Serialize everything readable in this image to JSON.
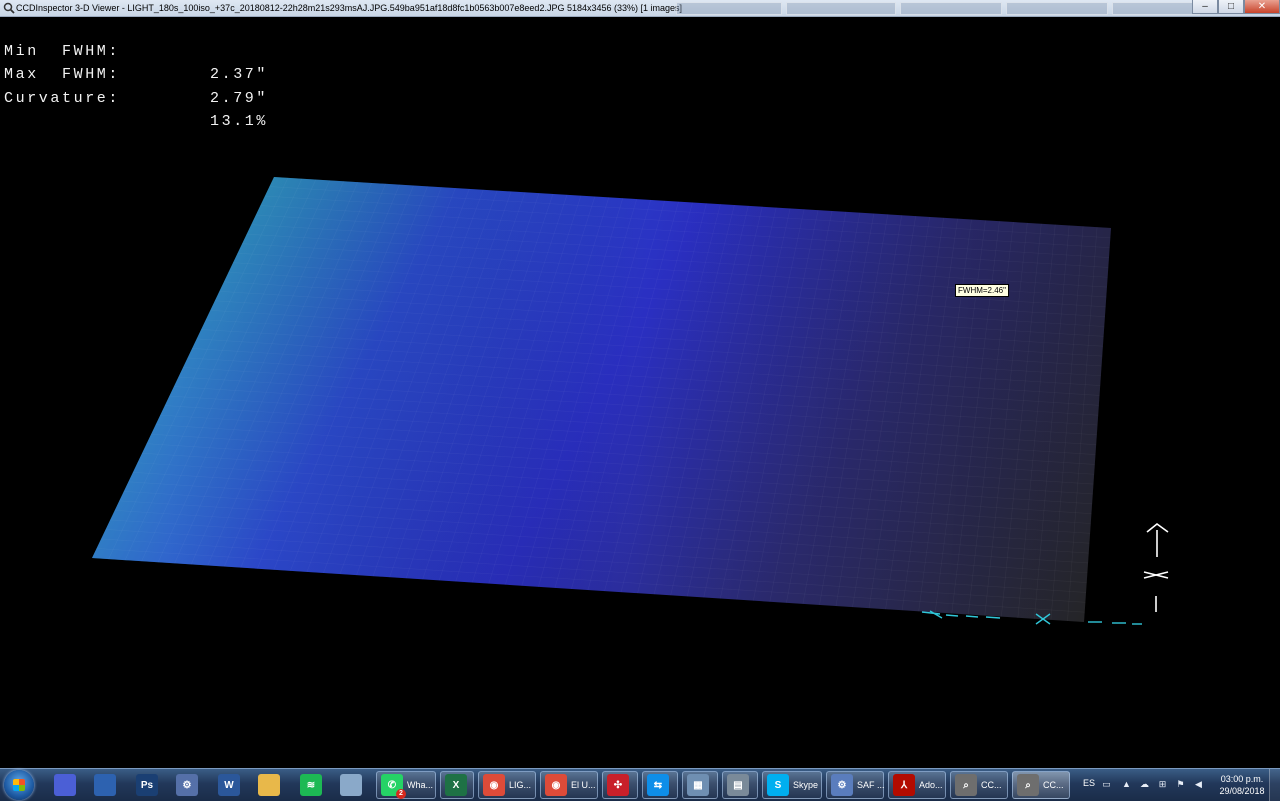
{
  "window": {
    "title": "CCDInspector 3-D Viewer - LIGHT_180s_100iso_+37c_20180812-22h28m21s293msAJ.JPG.549ba951af18d8fc1b0563b007e8eed2.JPG 5184x3456 (33%)  [1 images]",
    "controls": {
      "minimize": "–",
      "maximize": "□",
      "close": "✕"
    }
  },
  "stats": [
    {
      "label": "Min  FWHM:",
      "value": "2.37\""
    },
    {
      "label": "Max  FWHM:",
      "value": "2.79\""
    },
    {
      "label": "Curvature:",
      "value": "13.1%"
    }
  ],
  "tooltip": "FWHM=2.46\"",
  "colors": {
    "background": "#000000",
    "surface_hi": "#2aa7b3",
    "surface_mid": "#2a2fd0",
    "surface_lo": "#2b2b2d",
    "axis": "#ffffff",
    "axis_cyan": "#30c6d8"
  },
  "taskbar": {
    "pinned": [
      {
        "name": "virtualbox-icon",
        "text": "",
        "color": "#4b5fd6"
      },
      {
        "name": "network-admin-icon",
        "text": "",
        "color": "#2d62b0"
      },
      {
        "name": "photoshop-icon",
        "text": "Ps",
        "color": "#1a3f73"
      },
      {
        "name": "settings-gear-icon",
        "text": "⚙",
        "color": "#5570a8"
      },
      {
        "name": "word-icon",
        "text": "W",
        "color": "#2b579a"
      },
      {
        "name": "folder-icon",
        "text": "",
        "color": "#e8b84a"
      },
      {
        "name": "spotify-icon",
        "text": "≋",
        "color": "#1db954"
      },
      {
        "name": "notepad-icon",
        "text": "",
        "color": "#8aa9c9"
      }
    ],
    "windows": [
      {
        "name": "whatsapp-icon",
        "label": "Wha...",
        "color": "#25d366",
        "text": "✆",
        "badge": "2"
      },
      {
        "name": "excel-icon",
        "label": "",
        "color": "#1e7145",
        "text": "X"
      },
      {
        "name": "chrome-icon",
        "label": "LIG...",
        "color": "#dd4b39",
        "text": "◉"
      },
      {
        "name": "chrome-icon",
        "label": "El U...",
        "color": "#dd4b39",
        "text": "◉"
      },
      {
        "name": "red-app-icon",
        "label": "",
        "color": "#c8202a",
        "text": "✣"
      },
      {
        "name": "teamviewer-icon",
        "label": "",
        "color": "#0e8ee9",
        "text": "⇆"
      },
      {
        "name": "remote-desktop-icon",
        "label": "",
        "color": "#6f8fb2",
        "text": "▦"
      },
      {
        "name": "calculator-icon",
        "label": "",
        "color": "#7a8a99",
        "text": "▤"
      },
      {
        "name": "skype-icon",
        "label": "Skype",
        "color": "#00aff0",
        "text": "S"
      },
      {
        "name": "sap-gear-icon",
        "label": "SAF ...",
        "color": "#5a7dbd",
        "text": "⚙"
      },
      {
        "name": "adobe-icon",
        "label": "Ado...",
        "color": "#b30b00",
        "text": "⅄"
      },
      {
        "name": "ccdinspector-icon",
        "label": "CC...",
        "color": "#6e6e6e",
        "text": "⌕"
      },
      {
        "name": "ccdinspector-icon",
        "label": "CC...",
        "color": "#6e6e6e",
        "text": "⌕"
      }
    ],
    "tray": {
      "language": "ES",
      "time": "03:00 p.m.",
      "date": "29/08/2018"
    }
  }
}
